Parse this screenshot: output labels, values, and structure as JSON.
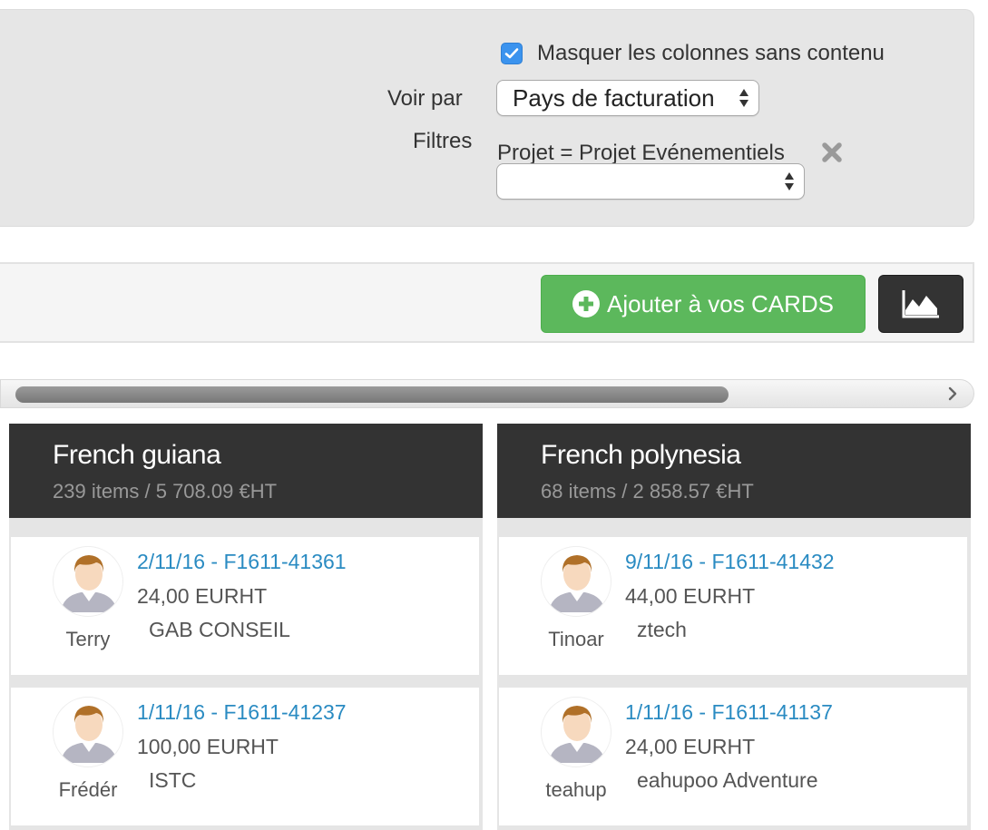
{
  "filters": {
    "hide_empty_label": "Masquer les colonnes sans contenu",
    "hide_empty_checked": true,
    "view_by_label": "Voir par",
    "view_by_value": "Pays de facturation",
    "filters_label": "Filtres",
    "active_filter": "Projet = Projet Evénementiels",
    "new_filter_value": ""
  },
  "toolbar": {
    "add_cards_label": "Ajouter à vos CARDS",
    "chart_icon": "area-chart-icon"
  },
  "colors": {
    "accent_green": "#5cb85c",
    "header_dark": "#333333",
    "link_blue": "#2a8bc2",
    "checkbox_blue": "#3b93ee"
  },
  "columns": [
    {
      "title": "French guiana",
      "summary": "239 items / 5 708.09 €HT",
      "cards": [
        {
          "ref": "2/11/16 - F1611-41361",
          "amount": "24,00 EURHT",
          "client": "GAB CONSEIL",
          "user": "Terry"
        },
        {
          "ref": "1/11/16 - F1611-41237",
          "amount": "100,00 EURHT",
          "client": "ISTC",
          "user": "Frédér"
        }
      ]
    },
    {
      "title": "French polynesia",
      "summary": "68 items / 2 858.57 €HT",
      "cards": [
        {
          "ref": "9/11/16 - F1611-41432",
          "amount": "44,00 EURHT",
          "client": "ztech",
          "user": "Tinoar"
        },
        {
          "ref": "1/11/16 - F1611-41137",
          "amount": "24,00 EURHT",
          "client": "eahupoo Adventure",
          "user": "teahup"
        }
      ]
    }
  ]
}
